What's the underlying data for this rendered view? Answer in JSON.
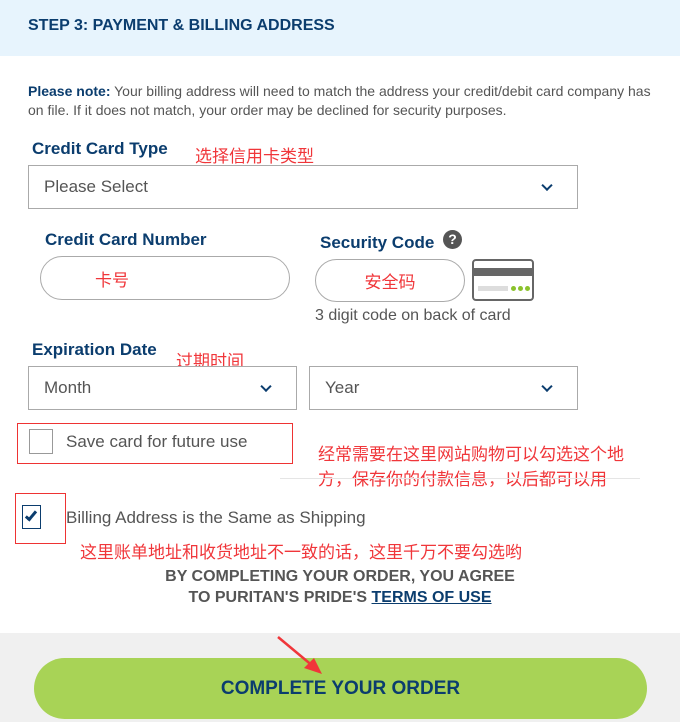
{
  "header": {
    "title": "STEP 3: PAYMENT & BILLING ADDRESS"
  },
  "note": {
    "label": "Please note:",
    "text": " Your billing address will need to match the address your credit/debit card company has on file. If it does not match, your order may be declined for security purposes."
  },
  "card_type": {
    "label": "Credit Card Type",
    "value": "Please Select",
    "annotation": "选择信用卡类型"
  },
  "card_number": {
    "label": "Credit Card Number",
    "annotation": "卡号"
  },
  "security_code": {
    "label": "Security Code",
    "annotation": "安全码",
    "hint": "3 digit code on back of card"
  },
  "expiration": {
    "label": "Expiration Date",
    "annotation": "过期时间",
    "month": "Month",
    "year": "Year"
  },
  "save_card": {
    "label": "Save card for future use",
    "checked": false,
    "annotation_line1": "经常需要在这里网站购物可以勾选这个地",
    "annotation_line2": "方，保存你的付款信息，以后都可以用"
  },
  "billing_same": {
    "label": "Billing Address is the Same as Shipping",
    "checked": true,
    "annotation": "这里账单地址和收货地址不一致的话，这里千万不要勾选哟"
  },
  "terms": {
    "line1": "BY COMPLETING YOUR ORDER, YOU AGREE",
    "line2_prefix": "TO PURITAN'S PRIDE'S ",
    "link": "TERMS OF USE"
  },
  "submit": {
    "label": "COMPLETE YOUR ORDER"
  },
  "colors": {
    "brand": "#0b3d6e",
    "button": "#a8d356",
    "annotation": "#f0363a"
  }
}
